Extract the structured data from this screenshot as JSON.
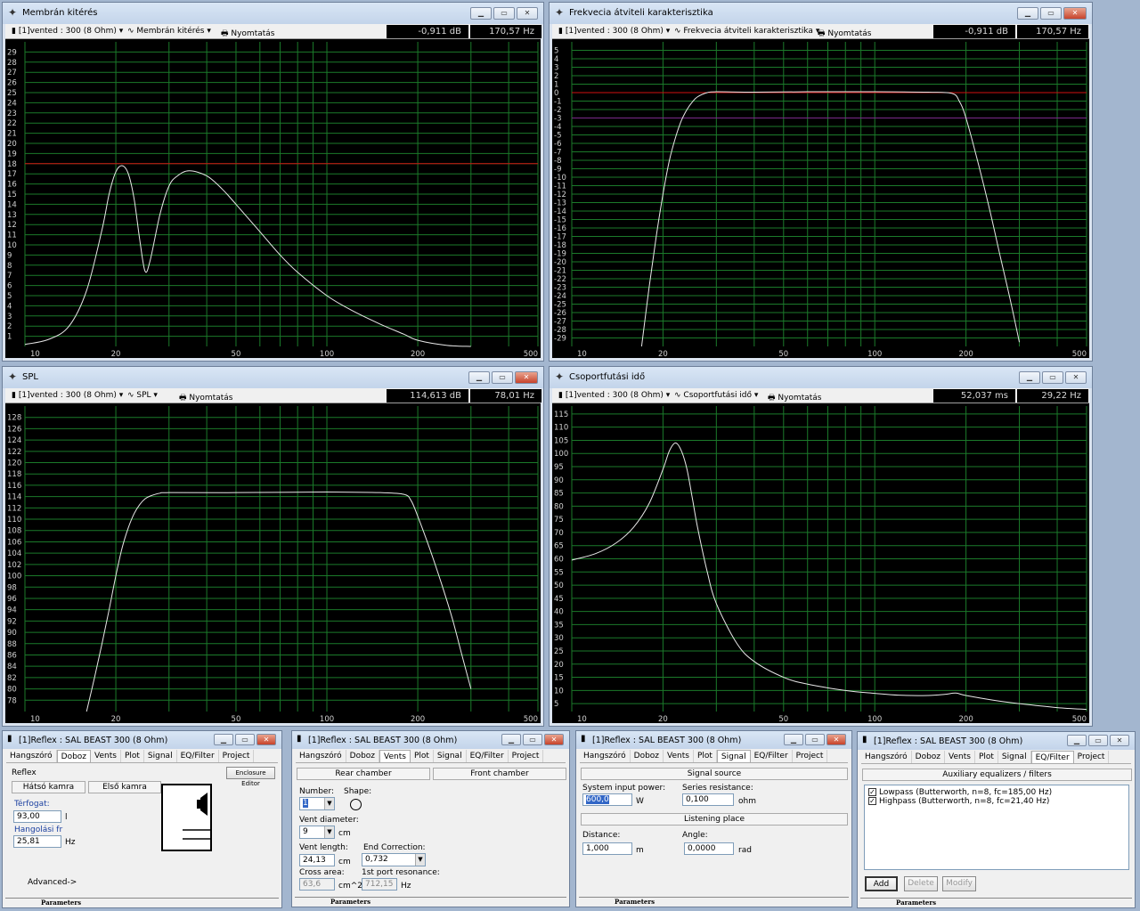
{
  "colors": {
    "grid": "#1b7a2a",
    "curve": "#e8e8e8",
    "ref_red": "#d01010",
    "ref_purple": "#7a2a8a",
    "ticks": "#d0d0d0"
  },
  "windows": [
    {
      "id": "w1",
      "title": "Membrán kitérés",
      "driver": "[1]vented : 300 (8 Ohm)",
      "mode": "Membrán kitérés",
      "print": "Nyomtatás",
      "readout1": "-0,911 dB",
      "readout2": "170,57 Hz"
    },
    {
      "id": "w2",
      "title": "Frekvecia átviteli karakterisztika",
      "driver": "[1]vented : 300 (8 Ohm)",
      "mode": "Frekvecia átviteli karakterisztika",
      "print": "Nyomtatás",
      "readout1": "-0,911 dB",
      "readout2": "170,57 Hz"
    },
    {
      "id": "w3",
      "title": "SPL",
      "driver": "[1]vented : 300 (8 Ohm)",
      "mode": "SPL",
      "print": "Nyomtatás",
      "readout1": "114,613 dB",
      "readout2": "78,01 Hz"
    },
    {
      "id": "w4",
      "title": "Csoportfutási idő",
      "driver": "[1]vented : 300 (8 Ohm)",
      "mode": "Csoportfutási idő",
      "print": "Nyomtatás",
      "readout1": "52,037 ms",
      "readout2": "29,22 Hz"
    }
  ],
  "chart_data": [
    {
      "type": "line",
      "xscale": "log",
      "xlim": [
        10,
        500
      ],
      "ylim": [
        0,
        30
      ],
      "xticks": [
        10,
        20,
        50,
        100,
        200,
        500
      ],
      "yticks": [
        1,
        2,
        3,
        4,
        5,
        6,
        7,
        8,
        9,
        10,
        11,
        12,
        13,
        14,
        15,
        16,
        17,
        18,
        19,
        20,
        21,
        22,
        23,
        24,
        25,
        26,
        27,
        28,
        29
      ],
      "ref_lines": [
        {
          "y": 18,
          "color": "red"
        }
      ],
      "x": [
        10,
        12,
        14,
        16,
        18,
        19,
        20,
        21,
        22,
        23,
        24,
        25,
        26,
        28,
        30,
        32,
        35,
        40,
        45,
        50,
        60,
        70,
        80,
        100,
        120,
        150,
        180,
        200,
        250,
        300
      ],
      "y": [
        0.2,
        0.7,
        2,
        5.5,
        11.5,
        15,
        17.2,
        17.8,
        17,
        14.5,
        10.5,
        7.4,
        8.5,
        13,
        15.8,
        16.8,
        17.3,
        16.8,
        15.5,
        14,
        11.3,
        9,
        7.3,
        5,
        3.6,
        2.2,
        1.2,
        0.6,
        0.1,
        0
      ]
    },
    {
      "type": "line",
      "xscale": "log",
      "xlim": [
        10,
        500
      ],
      "ylim": [
        -30,
        6
      ],
      "xticks": [
        10,
        20,
        50,
        100,
        200,
        500
      ],
      "yticks": [
        5,
        4,
        3,
        2,
        1,
        0,
        -1,
        -2,
        -3,
        -4,
        -5,
        -6,
        -7,
        -8,
        -9,
        -10,
        -11,
        -12,
        -13,
        -14,
        -15,
        -16,
        -17,
        -18,
        -19,
        -20,
        -21,
        -22,
        -23,
        -24,
        -25,
        -26,
        -27,
        -28,
        -29
      ],
      "ref_lines": [
        {
          "y": 0,
          "color": "red"
        },
        {
          "y": -3,
          "color": "purple"
        }
      ],
      "x": [
        17,
        18,
        19,
        20,
        21,
        22,
        23,
        24,
        25,
        26,
        28,
        30,
        40,
        60,
        100,
        150,
        180,
        190,
        200,
        220,
        240,
        260,
        280,
        300
      ],
      "y": [
        -30,
        -23,
        -17,
        -12,
        -8,
        -5.3,
        -3.3,
        -2,
        -1.1,
        -0.5,
        0,
        0.1,
        0.05,
        0.1,
        0.1,
        0.05,
        -0.1,
        -1,
        -3,
        -8.5,
        -14,
        -19.5,
        -24.5,
        -29.5
      ]
    },
    {
      "type": "line",
      "xscale": "log",
      "xlim": [
        10,
        500
      ],
      "ylim": [
        76,
        130
      ],
      "xticks": [
        10,
        20,
        50,
        100,
        200,
        500
      ],
      "yticks": [
        78,
        80,
        82,
        84,
        86,
        88,
        90,
        92,
        94,
        96,
        98,
        100,
        102,
        104,
        106,
        108,
        110,
        112,
        114,
        116,
        118,
        120,
        122,
        124,
        126,
        128
      ],
      "x": [
        16,
        17,
        18,
        19,
        20,
        21,
        22,
        23,
        24,
        25,
        26,
        28,
        30,
        50,
        100,
        150,
        180,
        190,
        200,
        220,
        240,
        260,
        280,
        300
      ],
      "y": [
        76,
        82,
        88,
        94,
        100,
        105,
        108.5,
        111,
        112.6,
        113.6,
        114.1,
        114.6,
        114.7,
        114.7,
        114.8,
        114.7,
        114.4,
        113.3,
        110.5,
        104.5,
        98.5,
        92.5,
        86,
        80
      ]
    },
    {
      "type": "line",
      "xscale": "log",
      "xlim": [
        10,
        500
      ],
      "ylim": [
        2,
        118
      ],
      "xticks": [
        10,
        20,
        50,
        100,
        200,
        500
      ],
      "yticks": [
        5,
        10,
        15,
        20,
        25,
        30,
        35,
        40,
        45,
        50,
        55,
        60,
        65,
        70,
        75,
        80,
        85,
        90,
        95,
        100,
        105,
        110,
        115
      ],
      "x": [
        10,
        12,
        14,
        16,
        18,
        20,
        21,
        22,
        23,
        24,
        25,
        26,
        28,
        30,
        35,
        40,
        50,
        60,
        80,
        100,
        120,
        150,
        170,
        185,
        200,
        250,
        300,
        400,
        500
      ],
      "y": [
        59.5,
        62,
        66,
        72,
        81,
        94,
        101,
        104,
        101,
        94,
        83,
        72,
        55,
        43,
        28,
        21,
        15,
        12.4,
        10,
        8.9,
        8.2,
        8.1,
        8.5,
        9,
        8.1,
        6.2,
        5,
        3.5,
        2.8
      ]
    }
  ],
  "p1": {
    "title": "[1]Reflex : SAL BEAST 300 (8 Ohm)",
    "tabs": [
      "Hangszóró",
      "Doboz",
      "Vents",
      "Plot",
      "Signal",
      "EQ/Filter",
      "Project"
    ],
    "active": 1,
    "enclosure": "Reflex",
    "enclosure_btn": "Enclosure Editor",
    "rear": "Hátsó kamra",
    "front": "Első kamra",
    "volume_label": "Térfogat:",
    "volume": "93,00",
    "volume_unit": "l",
    "tuning_label": "Hangolási fr",
    "tuning": "25,81",
    "tuning_unit": "Hz",
    "advanced": "Advanced->",
    "footer": "Parameters"
  },
  "p2": {
    "title": "[1]Reflex : SAL BEAST 300 (8 Ohm)",
    "tabs": [
      "Hangszóró",
      "Doboz",
      "Vents",
      "Plot",
      "Signal",
      "EQ/Filter",
      "Project"
    ],
    "active": 2,
    "rear": "Rear chamber",
    "front": "Front chamber",
    "number_label": "Number:",
    "number": "1",
    "shape_label": "Shape:",
    "diam_label": "Vent diameter:",
    "diam": "9",
    "diam_unit": "cm",
    "len_label": "Vent length:",
    "len": "24,13",
    "len_unit": "cm",
    "endc_label": "End Correction:",
    "endc": "0,732",
    "area_label": "Cross area:",
    "area": "63,6",
    "area_unit": "cm^2",
    "res_label": "1st port resonance:",
    "res": "712,15",
    "res_unit": "Hz",
    "footer": "Parameters"
  },
  "p3": {
    "title": "[1]Reflex : SAL BEAST 300 (8 Ohm)",
    "tabs": [
      "Hangszóró",
      "Doboz",
      "Vents",
      "Plot",
      "Signal",
      "EQ/Filter",
      "Project"
    ],
    "active": 4,
    "source": "Signal source",
    "power_label": "System input power:",
    "power": "600,0",
    "power_unit": "W",
    "res_label": "Series resistance:",
    "res": "0,100",
    "res_unit": "ohm",
    "listen": "Listening place",
    "dist_label": "Distance:",
    "dist": "1,000",
    "dist_unit": "m",
    "angle_label": "Angle:",
    "angle": "0,0000",
    "angle_unit": "rad",
    "footer": "Parameters"
  },
  "p4": {
    "title": "[1]Reflex : SAL BEAST 300 (8 Ohm)",
    "tabs": [
      "Hangszóró",
      "Doboz",
      "Vents",
      "Plot",
      "Signal",
      "EQ/Filter",
      "Project"
    ],
    "active": 5,
    "aux": "Auxiliary equalizers / filters",
    "items": [
      "Lowpass (Butterworth, n=8, fc=185,00 Hz)",
      "Highpass (Butterworth, n=8, fc=21,40 Hz)"
    ],
    "add": "Add",
    "delete": "Delete",
    "modify": "Modify",
    "footer": "Parameters"
  }
}
